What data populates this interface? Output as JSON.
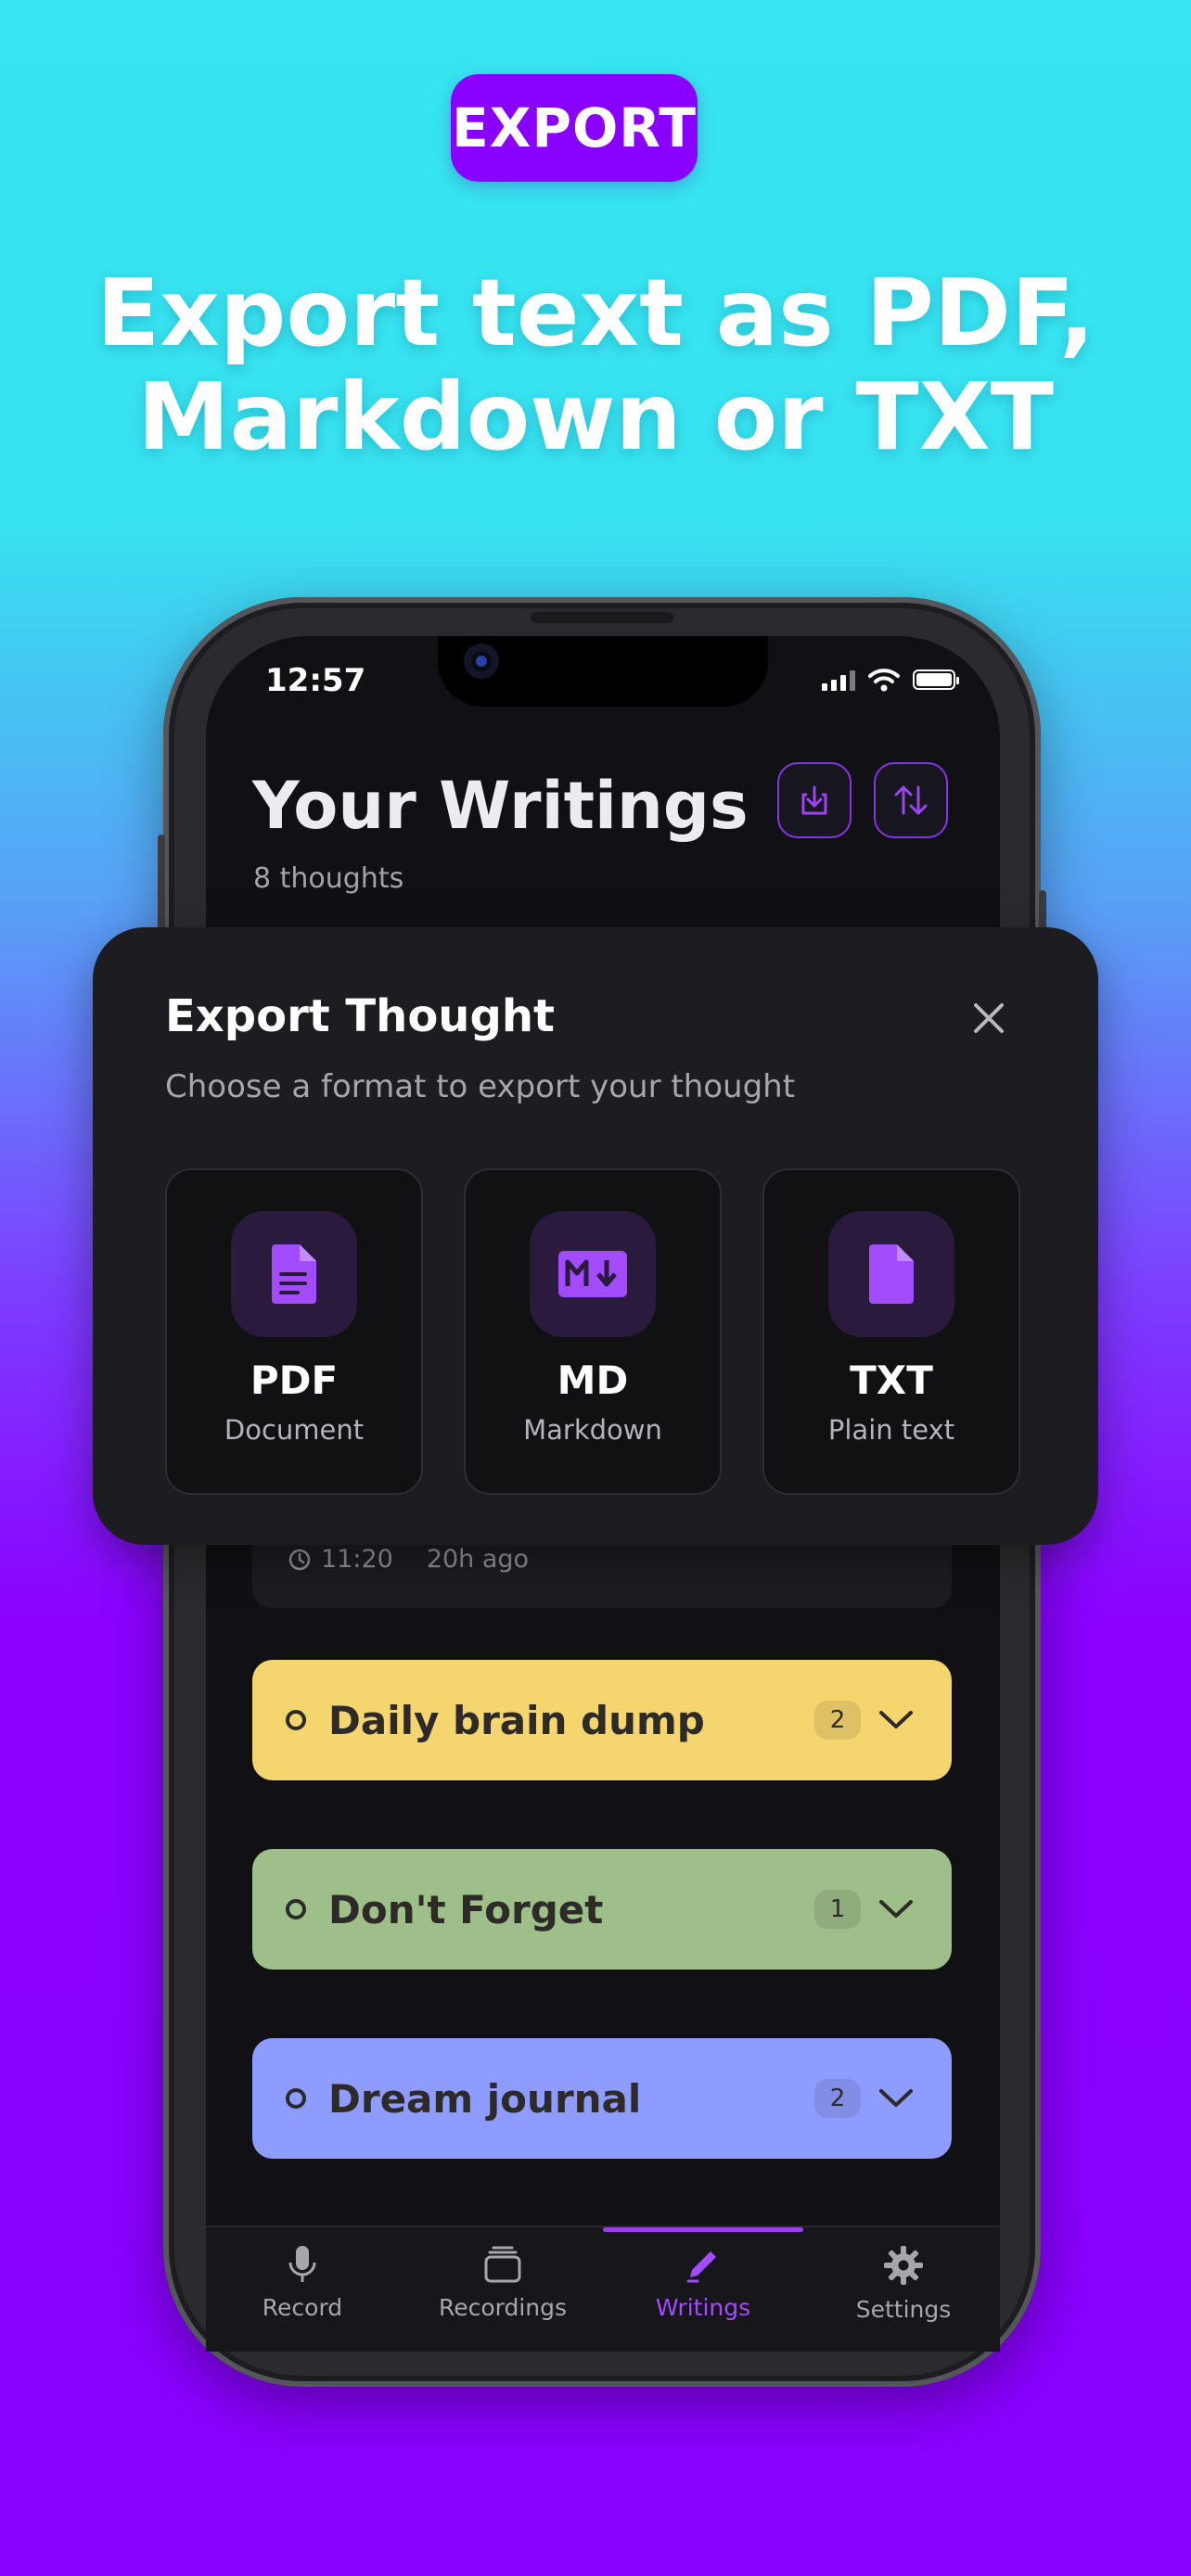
{
  "promo": {
    "badge": "EXPORT",
    "headline_line1": "Export text as PDF,",
    "headline_line2": "Markdown or TXT"
  },
  "status_bar": {
    "time": "12:57"
  },
  "header": {
    "title": "Your Writings",
    "subtitle": "8 thoughts",
    "export_button_icon": "download-icon",
    "sort_button_icon": "sort-icon"
  },
  "export_sheet": {
    "title": "Export Thought",
    "subtitle": "Choose a format to export your thought",
    "close_icon": "close-icon",
    "formats": [
      {
        "label": "PDF",
        "description": "Document",
        "icon": "pdf-file-icon"
      },
      {
        "label": "MD",
        "description": "Markdown",
        "icon": "markdown-icon"
      },
      {
        "label": "TXT",
        "description": "Plain text",
        "icon": "txt-file-icon"
      }
    ]
  },
  "recent_item": {
    "time": "11:20",
    "ago": "20h ago"
  },
  "folders": [
    {
      "name": "Daily brain dump",
      "count": "2",
      "color": "#f5d56e"
    },
    {
      "name": "Don't Forget",
      "count": "1",
      "color": "#9ebf89"
    },
    {
      "name": "Dream journal",
      "count": "2",
      "color": "#8f9cff"
    }
  ],
  "tabs": [
    {
      "label": "Record",
      "icon": "microphone-icon",
      "active": false
    },
    {
      "label": "Recordings",
      "icon": "stack-icon",
      "active": false
    },
    {
      "label": "Writings",
      "icon": "pencil-icon",
      "active": true
    },
    {
      "label": "Settings",
      "icon": "gear-icon",
      "active": false
    }
  ],
  "colors": {
    "accent": "#8a00ff",
    "accent_light": "#a24bff",
    "background_top": "#36e5f0",
    "background_bottom": "#8a00ff",
    "screen": "#111115",
    "sheet": "#1c1c21"
  }
}
